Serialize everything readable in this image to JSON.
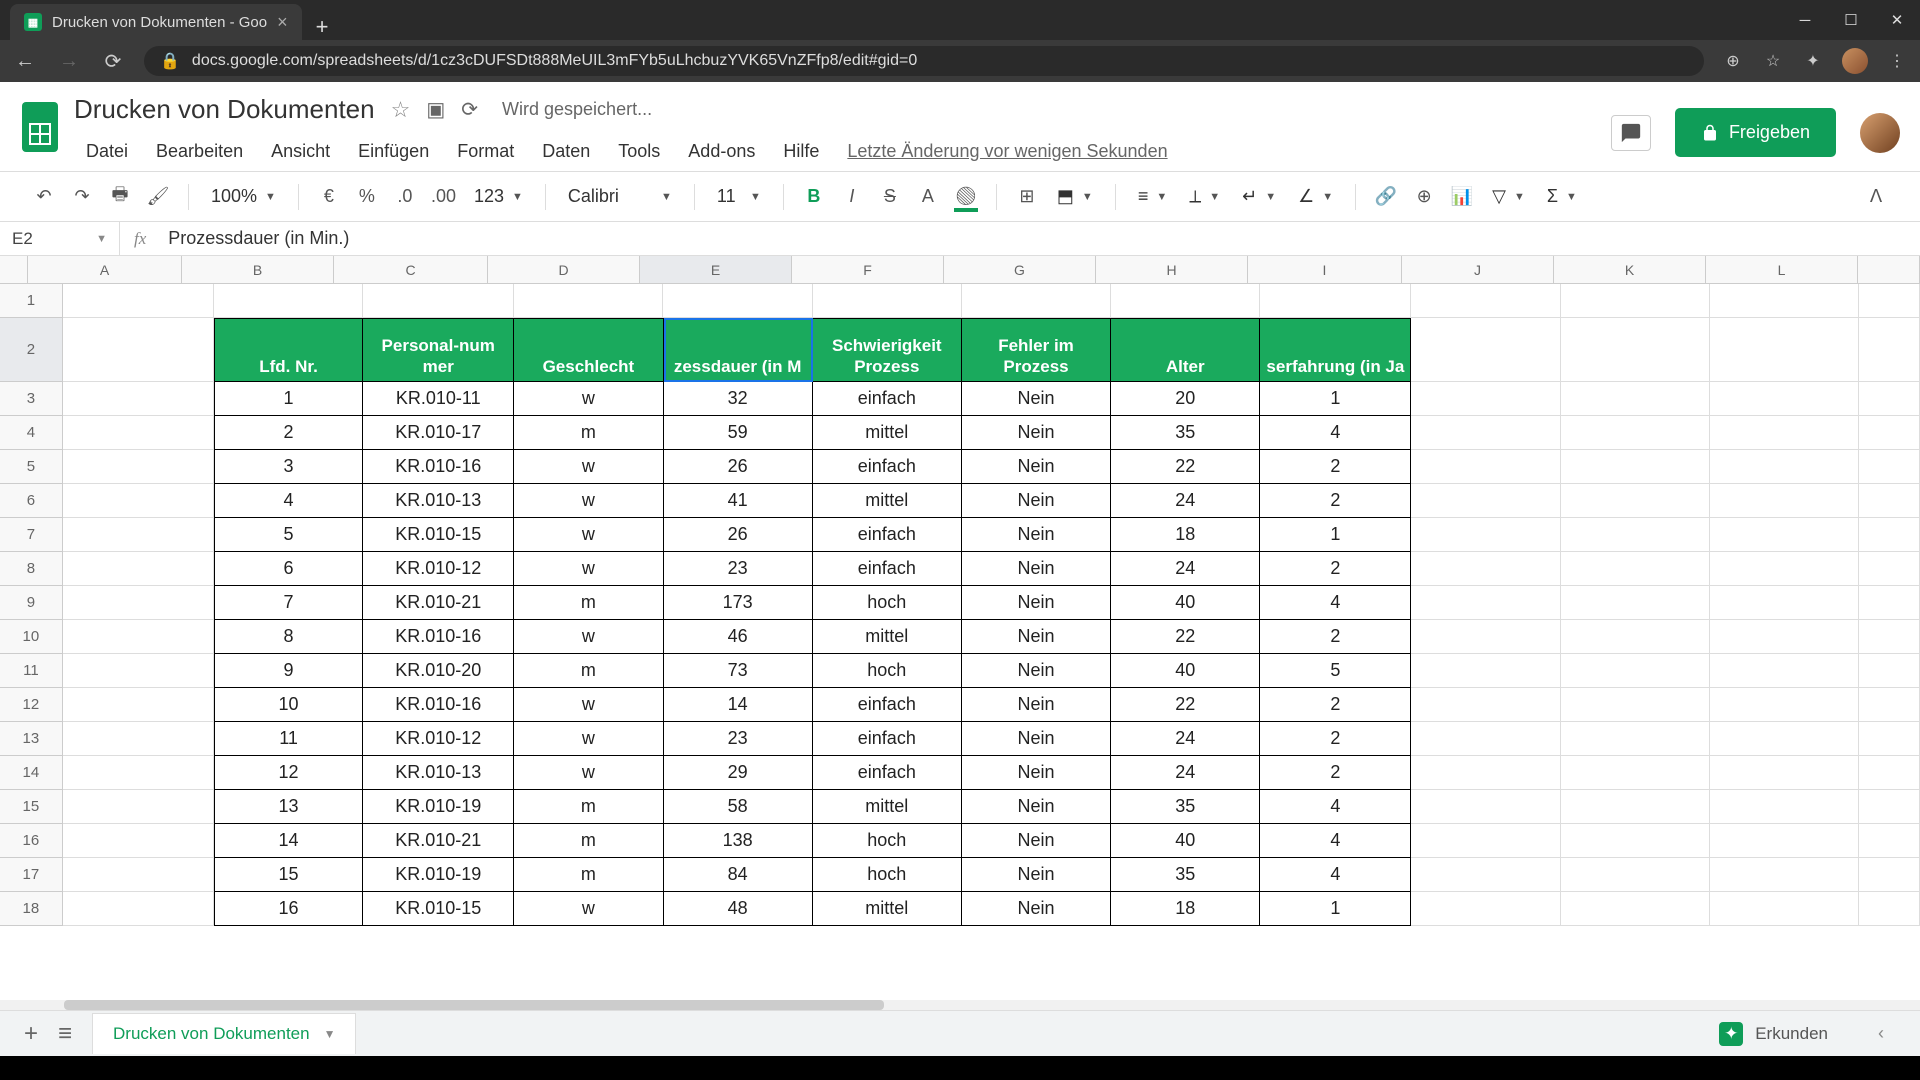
{
  "browser": {
    "tab_title": "Drucken von Dokumenten - Goo",
    "url": "docs.google.com/spreadsheets/d/1cz3cDUFSDt888MeUIL3mFYb5uLhcbuzYVK65VnZFfp8/edit#gid=0"
  },
  "doc": {
    "title": "Drucken von Dokumenten",
    "saving": "Wird gespeichert...",
    "last_change": "Letzte Änderung vor wenigen Sekunden",
    "share_label": "Freigeben"
  },
  "menu": {
    "file": "Datei",
    "edit": "Bearbeiten",
    "view": "Ansicht",
    "insert": "Einfügen",
    "format": "Format",
    "data": "Daten",
    "tools": "Tools",
    "addons": "Add-ons",
    "help": "Hilfe"
  },
  "toolbar": {
    "zoom": "100%",
    "font": "Calibri",
    "font_size": "11",
    "format_number": "123"
  },
  "formula_bar": {
    "cell_ref": "E2",
    "formula": "Prozessdauer (in Min.)"
  },
  "columns": [
    "A",
    "B",
    "C",
    "D",
    "E",
    "F",
    "G",
    "H",
    "I",
    "J",
    "K",
    "L"
  ],
  "selected_cell": "E2",
  "table": {
    "headers": [
      "Lfd. Nr.",
      "Personal-num\nmer",
      "Geschlecht",
      "zessdauer (in M",
      "Schwierigkeit Prozess",
      "Fehler im Prozess",
      "Alter",
      "serfahrung (in Ja"
    ],
    "rows": [
      [
        "1",
        "KR.010-11",
        "w",
        "32",
        "einfach",
        "Nein",
        "20",
        "1"
      ],
      [
        "2",
        "KR.010-17",
        "m",
        "59",
        "mittel",
        "Nein",
        "35",
        "4"
      ],
      [
        "3",
        "KR.010-16",
        "w",
        "26",
        "einfach",
        "Nein",
        "22",
        "2"
      ],
      [
        "4",
        "KR.010-13",
        "w",
        "41",
        "mittel",
        "Nein",
        "24",
        "2"
      ],
      [
        "5",
        "KR.010-15",
        "w",
        "26",
        "einfach",
        "Nein",
        "18",
        "1"
      ],
      [
        "6",
        "KR.010-12",
        "w",
        "23",
        "einfach",
        "Nein",
        "24",
        "2"
      ],
      [
        "7",
        "KR.010-21",
        "m",
        "173",
        "hoch",
        "Nein",
        "40",
        "4"
      ],
      [
        "8",
        "KR.010-16",
        "w",
        "46",
        "mittel",
        "Nein",
        "22",
        "2"
      ],
      [
        "9",
        "KR.010-20",
        "m",
        "73",
        "hoch",
        "Nein",
        "40",
        "5"
      ],
      [
        "10",
        "KR.010-16",
        "w",
        "14",
        "einfach",
        "Nein",
        "22",
        "2"
      ],
      [
        "11",
        "KR.010-12",
        "w",
        "23",
        "einfach",
        "Nein",
        "24",
        "2"
      ],
      [
        "12",
        "KR.010-13",
        "w",
        "29",
        "einfach",
        "Nein",
        "24",
        "2"
      ],
      [
        "13",
        "KR.010-19",
        "m",
        "58",
        "mittel",
        "Nein",
        "35",
        "4"
      ],
      [
        "14",
        "KR.010-21",
        "m",
        "138",
        "hoch",
        "Nein",
        "40",
        "4"
      ],
      [
        "15",
        "KR.010-19",
        "m",
        "84",
        "hoch",
        "Nein",
        "35",
        "4"
      ],
      [
        "16",
        "KR.010-15",
        "w",
        "48",
        "mittel",
        "Nein",
        "18",
        "1"
      ]
    ]
  },
  "sheet_tabs": {
    "active": "Drucken von Dokumenten",
    "explore": "Erkunden"
  },
  "colors": {
    "accent": "#0f9d58",
    "header_green": "#1aaa5d",
    "selection_blue": "#1a73e8"
  }
}
